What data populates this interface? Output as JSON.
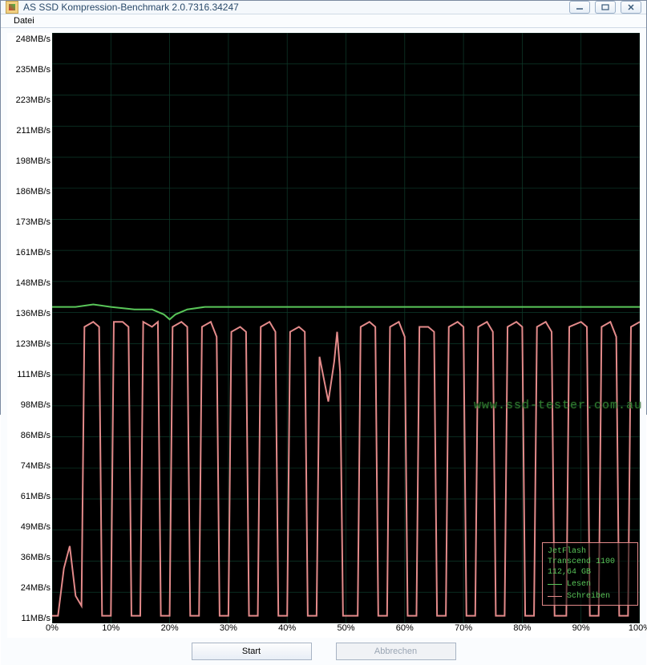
{
  "window": {
    "title": "AS SSD Kompression-Benchmark 2.0.7316.34247"
  },
  "menu": {
    "datei": "Datei"
  },
  "buttons": {
    "start": "Start",
    "abort": "Abbrechen"
  },
  "legend": {
    "device": "JetFlash Transcend 1100",
    "capacity": "112,64 GB",
    "read": "Lesen",
    "write": "Schreiben"
  },
  "colors": {
    "read": "#59c659",
    "write": "#e38a8a",
    "grid": "#0e3a2a",
    "legend_text": "#59c659"
  },
  "watermark": "www.ssd-tester.com.au",
  "chart_data": {
    "type": "line",
    "title": "",
    "xlabel": "",
    "ylabel": "",
    "xlim": [
      0,
      100
    ],
    "ylim": [
      11,
      248
    ],
    "x_ticks": [
      "0%",
      "10%",
      "20%",
      "30%",
      "40%",
      "50%",
      "60%",
      "70%",
      "80%",
      "90%",
      "100%"
    ],
    "y_ticks": [
      "248MB/s",
      "235MB/s",
      "223MB/s",
      "211MB/s",
      "198MB/s",
      "186MB/s",
      "173MB/s",
      "161MB/s",
      "148MB/s",
      "136MB/s",
      "123MB/s",
      "111MB/s",
      "98MB/s",
      "86MB/s",
      "74MB/s",
      "61MB/s",
      "49MB/s",
      "36MB/s",
      "24MB/s",
      "11MB/s"
    ],
    "series": [
      {
        "name": "Lesen",
        "color": "#59c659",
        "points": [
          [
            0,
            138
          ],
          [
            4,
            138
          ],
          [
            7,
            139
          ],
          [
            10,
            138
          ],
          [
            14,
            137
          ],
          [
            17,
            137
          ],
          [
            19,
            135
          ],
          [
            20,
            133
          ],
          [
            21,
            135
          ],
          [
            23,
            137
          ],
          [
            26,
            138
          ],
          [
            30,
            138
          ],
          [
            35,
            138
          ],
          [
            40,
            138
          ],
          [
            45,
            138
          ],
          [
            50,
            138
          ],
          [
            55,
            138
          ],
          [
            60,
            138
          ],
          [
            65,
            138
          ],
          [
            70,
            138
          ],
          [
            75,
            138
          ],
          [
            80,
            138
          ],
          [
            85,
            138
          ],
          [
            90,
            138
          ],
          [
            95,
            138
          ],
          [
            100,
            138
          ]
        ]
      },
      {
        "name": "Schreiben",
        "color": "#e38a8a",
        "points": [
          [
            0,
            14
          ],
          [
            1,
            14
          ],
          [
            2,
            33
          ],
          [
            3,
            42
          ],
          [
            4,
            22
          ],
          [
            5,
            18
          ],
          [
            5.5,
            130
          ],
          [
            7,
            132
          ],
          [
            8,
            130
          ],
          [
            8.5,
            14
          ],
          [
            10,
            14
          ],
          [
            10.5,
            132
          ],
          [
            12,
            132
          ],
          [
            13,
            130
          ],
          [
            13.5,
            14
          ],
          [
            15,
            14
          ],
          [
            15.5,
            132
          ],
          [
            17,
            130
          ],
          [
            18,
            132
          ],
          [
            18.5,
            14
          ],
          [
            20,
            14
          ],
          [
            20.5,
            130
          ],
          [
            22,
            132
          ],
          [
            23,
            130
          ],
          [
            23.5,
            14
          ],
          [
            25,
            14
          ],
          [
            25.5,
            130
          ],
          [
            27,
            132
          ],
          [
            28,
            126
          ],
          [
            28.5,
            14
          ],
          [
            30,
            14
          ],
          [
            30.5,
            128
          ],
          [
            32,
            130
          ],
          [
            33,
            128
          ],
          [
            33.5,
            14
          ],
          [
            35,
            14
          ],
          [
            35.5,
            130
          ],
          [
            37,
            132
          ],
          [
            38,
            128
          ],
          [
            38.5,
            14
          ],
          [
            40,
            14
          ],
          [
            40.5,
            128
          ],
          [
            42,
            130
          ],
          [
            43,
            128
          ],
          [
            43.5,
            14
          ],
          [
            45,
            14
          ],
          [
            45.5,
            118
          ],
          [
            47,
            100
          ],
          [
            48,
            116
          ],
          [
            48.5,
            128
          ],
          [
            49,
            112
          ],
          [
            49.5,
            14
          ],
          [
            51,
            14
          ],
          [
            52,
            14
          ],
          [
            52.5,
            130
          ],
          [
            54,
            132
          ],
          [
            55,
            130
          ],
          [
            55.5,
            14
          ],
          [
            57,
            14
          ],
          [
            57.5,
            130
          ],
          [
            59,
            132
          ],
          [
            60,
            126
          ],
          [
            60.5,
            14
          ],
          [
            62,
            14
          ],
          [
            62.5,
            130
          ],
          [
            64,
            130
          ],
          [
            65,
            128
          ],
          [
            65.5,
            14
          ],
          [
            67,
            14
          ],
          [
            67.5,
            130
          ],
          [
            69,
            132
          ],
          [
            70,
            130
          ],
          [
            70.5,
            14
          ],
          [
            72,
            14
          ],
          [
            72.5,
            130
          ],
          [
            74,
            132
          ],
          [
            75,
            128
          ],
          [
            75.5,
            14
          ],
          [
            77,
            14
          ],
          [
            77.5,
            130
          ],
          [
            79,
            132
          ],
          [
            80,
            130
          ],
          [
            80.5,
            14
          ],
          [
            82,
            14
          ],
          [
            82.5,
            130
          ],
          [
            84,
            132
          ],
          [
            85,
            128
          ],
          [
            85.5,
            14
          ],
          [
            87,
            14
          ],
          [
            87.5,
            14
          ],
          [
            88,
            130
          ],
          [
            90,
            132
          ],
          [
            91,
            130
          ],
          [
            91.5,
            14
          ],
          [
            93,
            14
          ],
          [
            93.5,
            130
          ],
          [
            95,
            132
          ],
          [
            96,
            126
          ],
          [
            96.5,
            14
          ],
          [
            98,
            14
          ],
          [
            98.5,
            130
          ],
          [
            100,
            132
          ]
        ]
      }
    ]
  }
}
